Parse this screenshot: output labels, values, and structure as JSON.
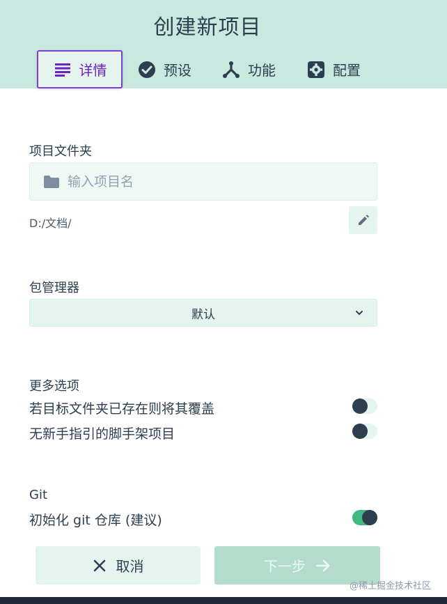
{
  "header": {
    "title": "创建新项目",
    "tabs": [
      {
        "label": "详情",
        "icon": "list-icon",
        "active": true
      },
      {
        "label": "预设",
        "icon": "check-circle-icon",
        "active": false
      },
      {
        "label": "功能",
        "icon": "merge-icon",
        "active": false
      },
      {
        "label": "配置",
        "icon": "gear-icon",
        "active": false
      }
    ]
  },
  "folder": {
    "label": "项目文件夹",
    "placeholder": "输入项目名",
    "value": "",
    "path": "D:/文档/"
  },
  "package_manager": {
    "label": "包管理器",
    "selected": "默认"
  },
  "more_options": {
    "label": "更多选项",
    "items": [
      {
        "label": "若目标文件夹已存在则将其覆盖",
        "enabled": false
      },
      {
        "label": "无新手指引的脚手架项目",
        "enabled": false
      }
    ]
  },
  "git": {
    "label": "Git",
    "init_label": "初始化 git 仓库 (建议)",
    "init_enabled": true
  },
  "footer": {
    "cancel_label": "取消",
    "next_label": "下一步"
  },
  "watermark": "@稀土掘金技术社区",
  "colors": {
    "header_bg": "#c9e8df",
    "accent": "#42b983",
    "active_tab": "#6a21c8",
    "text": "#2c3e50"
  }
}
